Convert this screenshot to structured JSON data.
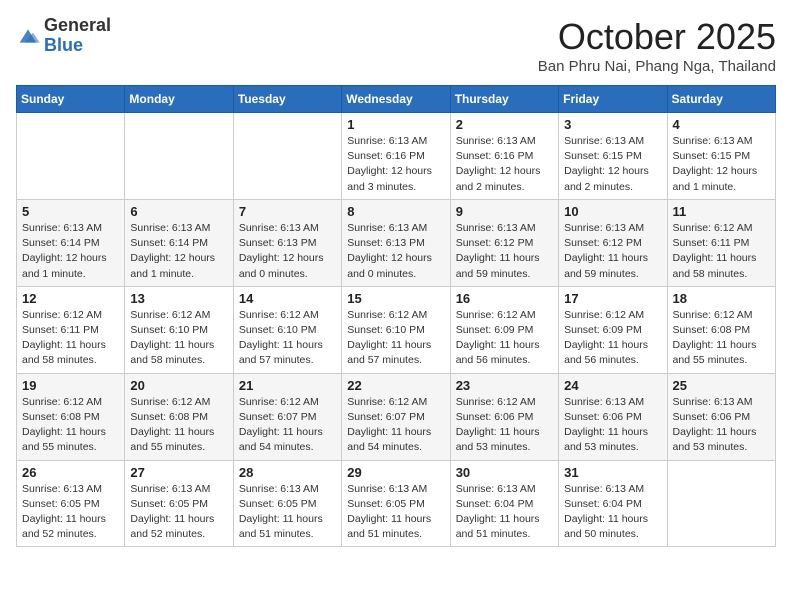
{
  "header": {
    "logo_general": "General",
    "logo_blue": "Blue",
    "month_title": "October 2025",
    "location": "Ban Phru Nai, Phang Nga, Thailand"
  },
  "weekdays": [
    "Sunday",
    "Monday",
    "Tuesday",
    "Wednesday",
    "Thursday",
    "Friday",
    "Saturday"
  ],
  "weeks": [
    [
      {
        "day": "",
        "info": ""
      },
      {
        "day": "",
        "info": ""
      },
      {
        "day": "",
        "info": ""
      },
      {
        "day": "1",
        "info": "Sunrise: 6:13 AM\nSunset: 6:16 PM\nDaylight: 12 hours and 3 minutes."
      },
      {
        "day": "2",
        "info": "Sunrise: 6:13 AM\nSunset: 6:16 PM\nDaylight: 12 hours and 2 minutes."
      },
      {
        "day": "3",
        "info": "Sunrise: 6:13 AM\nSunset: 6:15 PM\nDaylight: 12 hours and 2 minutes."
      },
      {
        "day": "4",
        "info": "Sunrise: 6:13 AM\nSunset: 6:15 PM\nDaylight: 12 hours and 1 minute."
      }
    ],
    [
      {
        "day": "5",
        "info": "Sunrise: 6:13 AM\nSunset: 6:14 PM\nDaylight: 12 hours and 1 minute."
      },
      {
        "day": "6",
        "info": "Sunrise: 6:13 AM\nSunset: 6:14 PM\nDaylight: 12 hours and 1 minute."
      },
      {
        "day": "7",
        "info": "Sunrise: 6:13 AM\nSunset: 6:13 PM\nDaylight: 12 hours and 0 minutes."
      },
      {
        "day": "8",
        "info": "Sunrise: 6:13 AM\nSunset: 6:13 PM\nDaylight: 12 hours and 0 minutes."
      },
      {
        "day": "9",
        "info": "Sunrise: 6:13 AM\nSunset: 6:12 PM\nDaylight: 11 hours and 59 minutes."
      },
      {
        "day": "10",
        "info": "Sunrise: 6:13 AM\nSunset: 6:12 PM\nDaylight: 11 hours and 59 minutes."
      },
      {
        "day": "11",
        "info": "Sunrise: 6:12 AM\nSunset: 6:11 PM\nDaylight: 11 hours and 58 minutes."
      }
    ],
    [
      {
        "day": "12",
        "info": "Sunrise: 6:12 AM\nSunset: 6:11 PM\nDaylight: 11 hours and 58 minutes."
      },
      {
        "day": "13",
        "info": "Sunrise: 6:12 AM\nSunset: 6:10 PM\nDaylight: 11 hours and 58 minutes."
      },
      {
        "day": "14",
        "info": "Sunrise: 6:12 AM\nSunset: 6:10 PM\nDaylight: 11 hours and 57 minutes."
      },
      {
        "day": "15",
        "info": "Sunrise: 6:12 AM\nSunset: 6:10 PM\nDaylight: 11 hours and 57 minutes."
      },
      {
        "day": "16",
        "info": "Sunrise: 6:12 AM\nSunset: 6:09 PM\nDaylight: 11 hours and 56 minutes."
      },
      {
        "day": "17",
        "info": "Sunrise: 6:12 AM\nSunset: 6:09 PM\nDaylight: 11 hours and 56 minutes."
      },
      {
        "day": "18",
        "info": "Sunrise: 6:12 AM\nSunset: 6:08 PM\nDaylight: 11 hours and 55 minutes."
      }
    ],
    [
      {
        "day": "19",
        "info": "Sunrise: 6:12 AM\nSunset: 6:08 PM\nDaylight: 11 hours and 55 minutes."
      },
      {
        "day": "20",
        "info": "Sunrise: 6:12 AM\nSunset: 6:08 PM\nDaylight: 11 hours and 55 minutes."
      },
      {
        "day": "21",
        "info": "Sunrise: 6:12 AM\nSunset: 6:07 PM\nDaylight: 11 hours and 54 minutes."
      },
      {
        "day": "22",
        "info": "Sunrise: 6:12 AM\nSunset: 6:07 PM\nDaylight: 11 hours and 54 minutes."
      },
      {
        "day": "23",
        "info": "Sunrise: 6:12 AM\nSunset: 6:06 PM\nDaylight: 11 hours and 53 minutes."
      },
      {
        "day": "24",
        "info": "Sunrise: 6:13 AM\nSunset: 6:06 PM\nDaylight: 11 hours and 53 minutes."
      },
      {
        "day": "25",
        "info": "Sunrise: 6:13 AM\nSunset: 6:06 PM\nDaylight: 11 hours and 53 minutes."
      }
    ],
    [
      {
        "day": "26",
        "info": "Sunrise: 6:13 AM\nSunset: 6:05 PM\nDaylight: 11 hours and 52 minutes."
      },
      {
        "day": "27",
        "info": "Sunrise: 6:13 AM\nSunset: 6:05 PM\nDaylight: 11 hours and 52 minutes."
      },
      {
        "day": "28",
        "info": "Sunrise: 6:13 AM\nSunset: 6:05 PM\nDaylight: 11 hours and 51 minutes."
      },
      {
        "day": "29",
        "info": "Sunrise: 6:13 AM\nSunset: 6:05 PM\nDaylight: 11 hours and 51 minutes."
      },
      {
        "day": "30",
        "info": "Sunrise: 6:13 AM\nSunset: 6:04 PM\nDaylight: 11 hours and 51 minutes."
      },
      {
        "day": "31",
        "info": "Sunrise: 6:13 AM\nSunset: 6:04 PM\nDaylight: 11 hours and 50 minutes."
      },
      {
        "day": "",
        "info": ""
      }
    ]
  ]
}
